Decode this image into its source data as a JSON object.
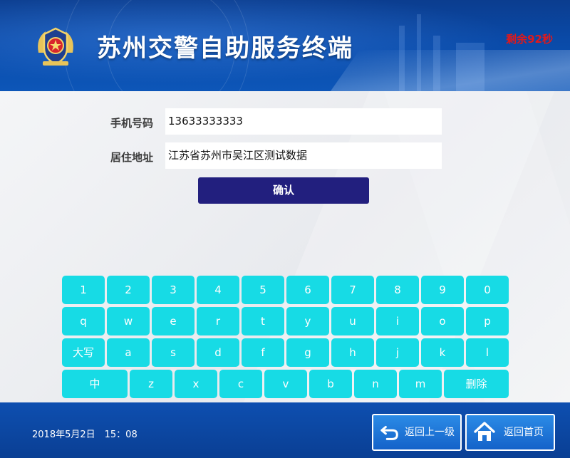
{
  "header": {
    "title": "苏州交警自助服务终端",
    "countdown": "剩余92秒",
    "emblem_icon": "police-emblem-icon"
  },
  "form": {
    "phone_label": "手机号码",
    "phone_value": "13633333333",
    "address_label": "居住地址",
    "address_value": "江苏省苏州市吴江区测试数据",
    "confirm_label": "确认"
  },
  "keyboard": {
    "row1": [
      "1",
      "2",
      "3",
      "4",
      "5",
      "6",
      "7",
      "8",
      "9",
      "0"
    ],
    "row2": [
      "q",
      "w",
      "e",
      "r",
      "t",
      "y",
      "u",
      "i",
      "o",
      "p"
    ],
    "row3": [
      "大写",
      "a",
      "s",
      "d",
      "f",
      "g",
      "h",
      "j",
      "k",
      "l"
    ],
    "row4": [
      "中",
      "z",
      "x",
      "c",
      "v",
      "b",
      "n",
      "m",
      "删除"
    ]
  },
  "footer": {
    "datetime": "2018年5月2日　15：08",
    "back_label": "返回上一级",
    "back_icon": "return-arrow-icon",
    "home_label": "返回首页",
    "home_icon": "home-icon"
  },
  "colors": {
    "header_blue": "#0a4aa8",
    "countdown_red": "#e0191b",
    "confirm_navy": "#221f7e",
    "key_cyan": "#17dbe5",
    "footer_blue": "#0e4fb0"
  }
}
